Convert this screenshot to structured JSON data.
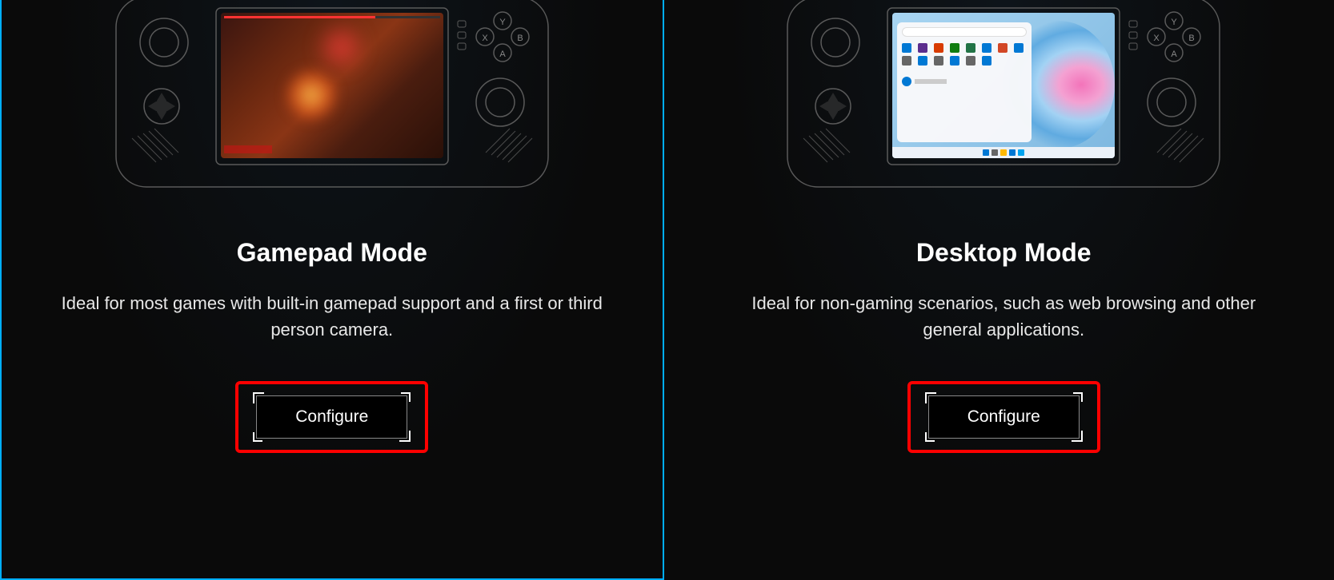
{
  "modes": {
    "gamepad": {
      "title": "Gamepad Mode",
      "description": "Ideal for most games with built-in gamepad support and a first or third person camera.",
      "button_label": "Configure",
      "selected": true
    },
    "desktop": {
      "title": "Desktop Mode",
      "description": "Ideal for non-gaming scenarios, such as web browsing and other general applications.",
      "button_label": "Configure",
      "selected": false
    }
  },
  "colors": {
    "accent": "#00aeff",
    "highlight": "#ff0000",
    "background": "#0a0a0a"
  }
}
